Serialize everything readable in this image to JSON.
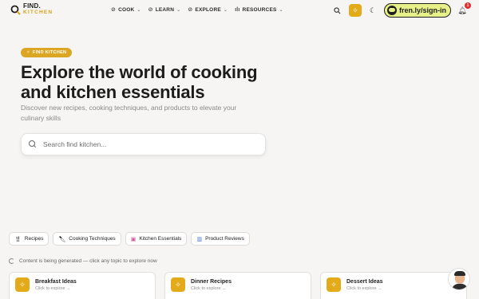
{
  "logo": {
    "line1": "FIND.",
    "line2": "KITCHEN"
  },
  "nav": [
    {
      "label": "COOK",
      "icon": "compass-icon"
    },
    {
      "label": "LEARN",
      "icon": "compass-icon"
    },
    {
      "label": "EXPLORE",
      "icon": "compass-icon"
    },
    {
      "label": "RESOURCES",
      "icon": "chart-icon"
    }
  ],
  "header": {
    "signin_label": "fren.ly/sign-in",
    "notification_count": "1"
  },
  "hero": {
    "pill_label": "FIND KITCHEN",
    "title": "Explore the world of cooking and kitchen essentials",
    "subtitle": "Discover new recipes, cooking techniques, and products to elevate your culinary skills"
  },
  "search": {
    "placeholder": "Search find kitchen...",
    "value": ""
  },
  "categories": [
    {
      "label": "Recipes",
      "icon": "utensils-icon"
    },
    {
      "label": "Cooking Techniques",
      "icon": "knife-icon"
    },
    {
      "label": "Kitchen Essentials",
      "icon": "gift-icon"
    },
    {
      "label": "Product Reviews",
      "icon": "bar-chart-icon"
    }
  ],
  "status_text": "Content is being generated — click any topic to explore now",
  "ideas": [
    {
      "title": "Breakfast Ideas",
      "sub": "Click to explore →"
    },
    {
      "title": "Dinner Recipes",
      "sub": "Click to explore →"
    },
    {
      "title": "Dessert Ideas",
      "sub": "Click to explore →"
    }
  ],
  "colors": {
    "accent": "#e3aa1a",
    "background": "#f6f5f3",
    "signin_bg": "#e8f08a",
    "badge": "#e02d2d"
  }
}
